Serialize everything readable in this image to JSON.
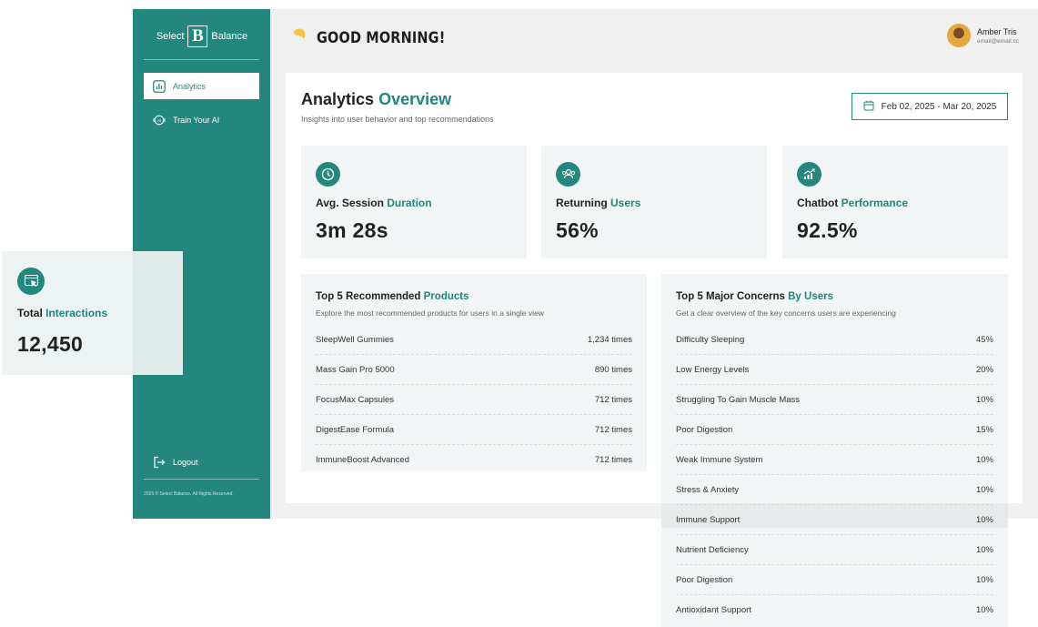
{
  "brand": {
    "left": "Select",
    "mark": "B",
    "right": "Balance"
  },
  "sidebar": {
    "items": [
      {
        "label": "Analytics",
        "icon": "bar-chart-icon",
        "active": true
      },
      {
        "label": "Train Your AI",
        "icon": "ai-icon",
        "active": false
      }
    ],
    "logout": "Logout",
    "footer": "2025 © Select Balance. All Rights Reserved."
  },
  "header": {
    "greeting": "GOOD MORNING!",
    "greeting_icon": "sun-cloud-icon"
  },
  "user": {
    "name": "Amber Tris",
    "email": "email@email.cc"
  },
  "page": {
    "title_plain": "Analytics",
    "title_accent": "Overview",
    "subtitle": "Insights into user behavior and top recommendations",
    "date_range": "Feb 02, 2025 - Mar 20, 2025"
  },
  "stats": [
    {
      "label_plain": "Avg. Session",
      "label_accent": "Duration",
      "value": "3m 28s",
      "icon": "clock-icon"
    },
    {
      "label_plain": "Returning",
      "label_accent": "Users",
      "value": "56%",
      "icon": "users-icon"
    },
    {
      "label_plain": "Chatbot",
      "label_accent": "Performance",
      "value": "92.5%",
      "icon": "growth-chart-icon"
    },
    {
      "label_plain": "Total",
      "label_accent": "Interactions",
      "value": "12,450",
      "icon": "pointer-click-icon"
    }
  ],
  "products": {
    "title_plain": "Top 5 Recommended",
    "title_accent": "Products",
    "subtitle": "Explore the most recommended products for users in a single view",
    "rows": [
      {
        "name": "SleepWell Gummies",
        "value": "1,234 times"
      },
      {
        "name": "Mass Gain Pro 5000",
        "value": "890 times"
      },
      {
        "name": "FocusMax Capsules",
        "value": "712 times"
      },
      {
        "name": "DigestEase Formula",
        "value": "712 times"
      },
      {
        "name": "ImmuneBoost Advanced",
        "value": "712 times"
      }
    ]
  },
  "concerns": {
    "title_plain": "Top 5 Major Concerns",
    "title_accent": "By Users",
    "subtitle": "Get a clear overview of the key concerns users are experiencing",
    "rows": [
      {
        "name": "Difficulty Sleeping",
        "value": "45%"
      },
      {
        "name": "Low Energy Levels",
        "value": "20%"
      },
      {
        "name": "Struggling To Gain Muscle Mass",
        "value": "10%"
      },
      {
        "name": "Poor Digestion",
        "value": "15%"
      },
      {
        "name": "Weak Immune System",
        "value": "10%"
      },
      {
        "name": "Stress & Anxiety",
        "value": "10%"
      },
      {
        "name": "Immune Support",
        "value": "10%"
      },
      {
        "name": "Nutrient Deficiency",
        "value": "10%"
      },
      {
        "name": "Poor Digestion",
        "value": "10%"
      },
      {
        "name": "Antioxidant Support",
        "value": "10%"
      }
    ]
  },
  "colors": {
    "accent": "#24877e",
    "card_bg": "#f1f5f5",
    "app_bg": "#f0f0f0"
  }
}
